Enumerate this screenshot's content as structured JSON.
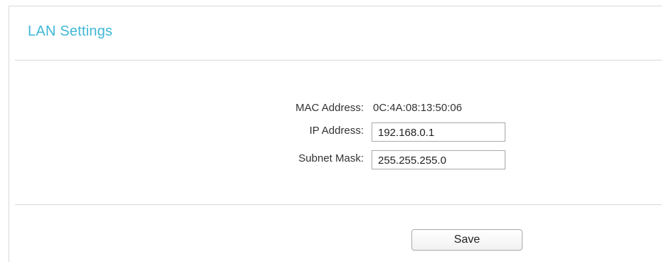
{
  "section": {
    "title": "LAN Settings"
  },
  "form": {
    "mac": {
      "label": "MAC Address:",
      "value": "0C:4A:08:13:50:06"
    },
    "ip": {
      "label": "IP Address:",
      "value": "192.168.0.1"
    },
    "subnet": {
      "label": "Subnet Mask:",
      "value": "255.255.255.0"
    }
  },
  "actions": {
    "save_label": "Save"
  },
  "colors": {
    "title": "#3fb7d7",
    "border": "#d9d9d9"
  }
}
